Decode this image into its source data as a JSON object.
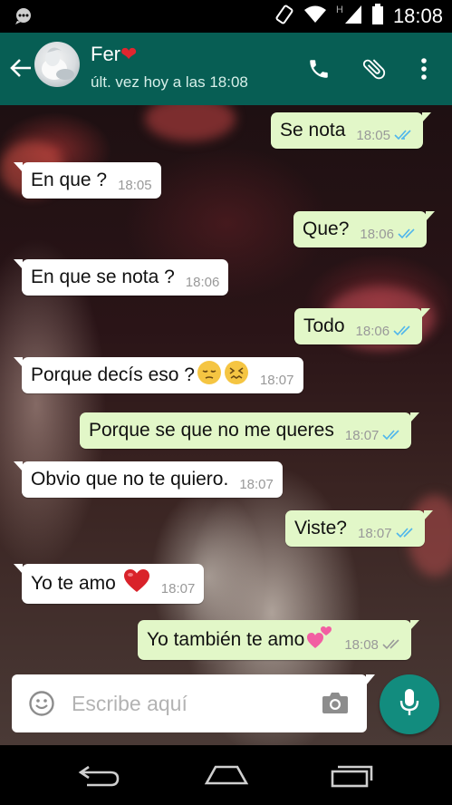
{
  "status_bar": {
    "time": "18:08",
    "network_label": "H",
    "icons": [
      "notification-icon",
      "rotation-icon",
      "wifi-icon",
      "signal-icon",
      "battery-icon"
    ]
  },
  "header": {
    "contact_name": "Fer",
    "name_emoji": "❤",
    "last_seen": "últ. vez hoy a las 18:08",
    "icons": [
      "back-arrow-icon",
      "phone-icon",
      "paperclip-icon",
      "more-vert-icon"
    ]
  },
  "messages": [
    {
      "dir": "out",
      "text": "Se nota",
      "time": "18:05",
      "status": "read"
    },
    {
      "dir": "in",
      "text": "En que ?",
      "time": "18:05"
    },
    {
      "dir": "out",
      "text": "Que?",
      "time": "18:06",
      "status": "read"
    },
    {
      "dir": "in",
      "text": "En que se nota ?",
      "time": "18:06"
    },
    {
      "dir": "out",
      "text": "Todo",
      "time": "18:06",
      "status": "read"
    },
    {
      "dir": "in",
      "text": "Porque decís eso ?",
      "emojis": [
        "pensive-face-emoji",
        "confounded-face-emoji"
      ],
      "time": "18:07"
    },
    {
      "dir": "out",
      "text": "Porque se que no me queres",
      "time": "18:07",
      "status": "read"
    },
    {
      "dir": "in",
      "text": "Obvio que no te quiero.",
      "time": "18:07"
    },
    {
      "dir": "out",
      "text": "Viste?",
      "time": "18:07",
      "status": "read"
    },
    {
      "dir": "in",
      "text": "Yo te amo",
      "emojis": [
        "red-heart-emoji"
      ],
      "time": "18:07"
    },
    {
      "dir": "out",
      "text": "Yo también te amo",
      "emojis": [
        "two-hearts-emoji"
      ],
      "time": "18:08",
      "status": "delivered"
    }
  ],
  "composer": {
    "placeholder": "Escribe aquí",
    "value": ""
  },
  "colors": {
    "header_bg": "#075e54",
    "outgoing_bubble": "#e2f7c8",
    "incoming_bubble": "#ffffff",
    "mic_button": "#128c7e",
    "read_ticks": "#4fb6ec",
    "delivered_ticks": "#9a9a9a"
  },
  "nav_bar": {
    "icons": [
      "back-nav-icon",
      "home-nav-icon",
      "recents-nav-icon"
    ]
  }
}
